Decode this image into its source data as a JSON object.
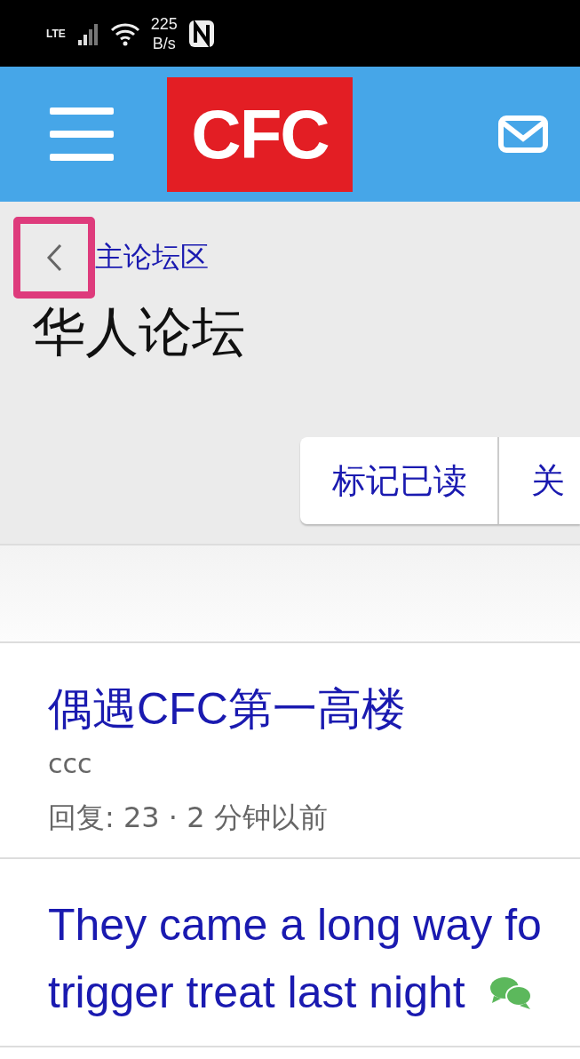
{
  "status_bar": {
    "network": "LTE",
    "speed_value": "225",
    "speed_unit": "B/s"
  },
  "header": {
    "logo": "CFC"
  },
  "breadcrumb": {
    "back_highlighted": true,
    "label": "主论坛区"
  },
  "page_title": "华人论坛",
  "actions": [
    {
      "label": "标记已读"
    },
    {
      "label": "关"
    }
  ],
  "threads": [
    {
      "title_lines": [
        "偶遇CFC第一高楼"
      ],
      "author": "ccc",
      "meta": "回复: 23 · 2 分钟以前",
      "has_chat_icon": false
    },
    {
      "title_lines": [
        "They came a long way fo",
        "trigger treat last night"
      ],
      "has_chat_icon": true
    }
  ]
}
